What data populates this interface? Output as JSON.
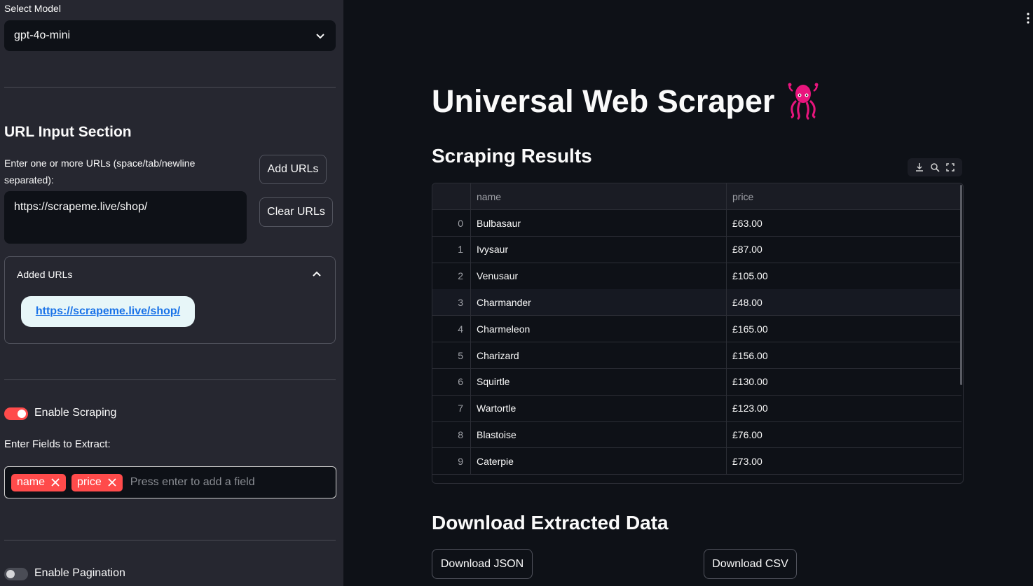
{
  "sidebar": {
    "model_label": "Select Model",
    "model_value": "gpt-4o-mini",
    "url_section_title": "URL Input Section",
    "url_input_label": "Enter one or more URLs (space/tab/newline separated):",
    "url_input_value": "https://scrapeme.live/shop/",
    "add_urls_label": "Add URLs",
    "clear_urls_label": "Clear URLs",
    "added_urls_title": "Added URLs",
    "added_urls": [
      "https://scrapeme.live/shop/"
    ],
    "enable_scraping_label": "Enable Scraping",
    "enable_scraping_on": true,
    "fields_label": "Enter Fields to Extract:",
    "fields": [
      "name",
      "price"
    ],
    "fields_placeholder": "Press enter to add a field",
    "enable_pagination_label": "Enable Pagination",
    "enable_pagination_on": false
  },
  "main": {
    "title": "Universal Web Scraper",
    "title_icon": "squid-icon",
    "results_title": "Scraping Results",
    "table": {
      "columns": [
        "name",
        "price"
      ],
      "rows": [
        {
          "index": "0",
          "name": "Bulbasaur",
          "price": "£63.00"
        },
        {
          "index": "1",
          "name": "Ivysaur",
          "price": "£87.00"
        },
        {
          "index": "2",
          "name": "Venusaur",
          "price": "£105.00"
        },
        {
          "index": "3",
          "name": "Charmander",
          "price": "£48.00"
        },
        {
          "index": "4",
          "name": "Charmeleon",
          "price": "£165.00"
        },
        {
          "index": "5",
          "name": "Charizard",
          "price": "£156.00"
        },
        {
          "index": "6",
          "name": "Squirtle",
          "price": "£130.00"
        },
        {
          "index": "7",
          "name": "Wartortle",
          "price": "£123.00"
        },
        {
          "index": "8",
          "name": "Blastoise",
          "price": "£76.00"
        },
        {
          "index": "9",
          "name": "Caterpie",
          "price": "£73.00"
        }
      ]
    },
    "download_title": "Download Extracted Data",
    "download_json_label": "Download JSON",
    "download_csv_label": "Download CSV"
  },
  "colors": {
    "accent": "#ff4b4b",
    "sidebar_bg": "#262730",
    "main_bg": "#0e1117"
  }
}
